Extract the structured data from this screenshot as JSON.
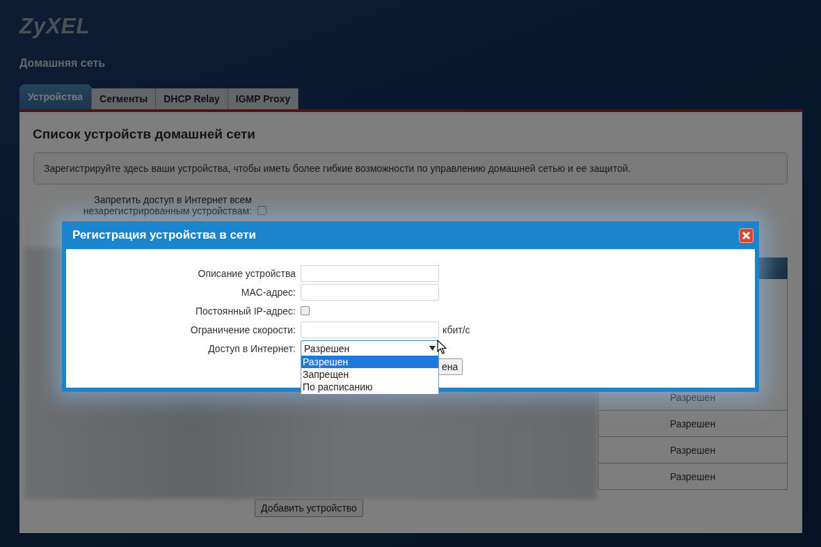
{
  "logo": "ZyXEL",
  "page_title": "Домашняя сеть",
  "tabs": [
    {
      "label": "Устройства",
      "selected": true
    },
    {
      "label": "Сегменты",
      "selected": false
    },
    {
      "label": "DHCP Relay",
      "selected": false
    },
    {
      "label": "IGMP Proxy",
      "selected": false
    }
  ],
  "panel": {
    "title": "Список устройств домашней сети",
    "info": "Зарегистрируйте здесь ваши устройства, чтобы иметь более гибкие возможности по управлению домашней сетью и ее защитой.",
    "block_unregistered": {
      "label": "Запретить доступ в Интернет всем незарегистрированным устройствам:",
      "checked": false
    }
  },
  "table": {
    "rows": [
      {
        "access": "Разрешен"
      },
      {
        "access": "Разрешен"
      },
      {
        "access": "Разрешен"
      },
      {
        "access": "Разрешен"
      }
    ]
  },
  "add_button": "Добавить устройство",
  "dialog": {
    "title": "Регистрация устройства в сети",
    "fields": [
      {
        "kind": "text",
        "label": "Описание устройства"
      },
      {
        "kind": "text",
        "label": "MAC-адрес:"
      },
      {
        "kind": "checkbox",
        "label": "Постоянный IP-адрес:",
        "checked": false
      },
      {
        "kind": "text",
        "label": "Ограничение скорости:",
        "unit": "кбит/с"
      },
      {
        "kind": "select",
        "label": "Доступ в Интернет:",
        "value": "Разрешен",
        "expanded": true,
        "options": [
          {
            "label": "Разрешен",
            "selected": true
          },
          {
            "label": "Запрещен",
            "selected": false
          },
          {
            "label": "По расписанию",
            "selected": false
          }
        ]
      }
    ],
    "button_partial": "ена"
  }
}
